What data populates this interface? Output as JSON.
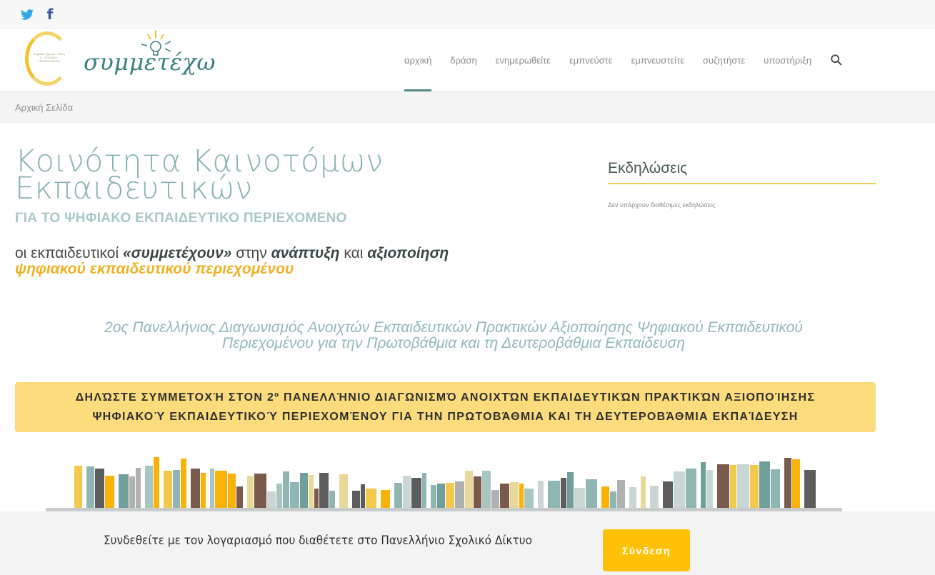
{
  "social": {
    "twitter_icon": "twitter-icon",
    "facebook_glyph": "f"
  },
  "logo": {
    "wordmark": "συμμετέχω",
    "tagline": "Ψηφιακό Σχολείο · Φάση Α · ΣΧΟΛΙΚΟ · ΠΕΡΙΕΧΟΜΕΝΟ"
  },
  "nav": {
    "items": [
      "αρχική",
      "δράση",
      "ενημερωθείτε",
      "εμπνεύστε",
      "εμπνευστείτε",
      "συζητήστε",
      "υποστήριξη"
    ],
    "active_index": 0,
    "search_icon": "search-icon"
  },
  "breadcrumb": "Αρχική Σελίδα",
  "hero": {
    "title_line1": "Κοινότητα Καινοτόμων",
    "title_line2": "Εκπαιδευτικών",
    "subtitle": "ΓΙΑ ΤΟ ΨΗΦΙΑΚΟ ΕΚΠΑΙΔΕΥΤΙΚΟ ΠΕΡΙΕΧΟΜΕΝΟ"
  },
  "tagline": {
    "part1": "οι εκπαιδευτικοί ",
    "bold1": "«συμμετέχουν»",
    "part2": " στην ",
    "bold2": "ανάπτυξη",
    "part3": " και ",
    "bold3": "αξιοποίηση",
    "line2": "ψηφιακού εκπαιδευτικού περιεχομένου"
  },
  "events": {
    "title": "Εκδηλώσεις",
    "empty_text": "Δεν υπάρχουν διαθέσιμες εκδηλώσεις"
  },
  "contest": {
    "line1": "2ος Πανελλήνιος Διαγωνισμός Ανοιχτών Εκπαιδευτικών Πρακτικών Αξιοποίησης Ψηφιακού Εκπαιδευτικού",
    "line2": "Περιεχομένου για την Πρωτοβάθμια και τη Δευτεροβάθμια Εκπαίδευση"
  },
  "banner": {
    "line1": "ΔΗΛΏΣΤΕ ΣΥΜΜΕΤΟΧΉ ΣΤΟΝ 2º ΠΑΝΕΛΛΉΝΙΟ ΔΙΑΓΩΝΙΣΜΌ ΑΝΟΙΧΤΏΝ ΕΚΠΑΙΔΕΥΤΙΚΏΝ ΠΡΑΚΤΙΚΏΝ ΑΞΙΟΠΟΊΗΣΗΣ",
    "line2": "ΨΗΦΙΑΚΟΎ ΕΚΠΑΙΔΕΥΤΙΚΟΎ ΠΕΡΙΕΧΟΜΈΝΟΥ ΓΙΑ ΤΗΝ ΠΡΩΤΟΒΆΘΜΙΑ ΚΑΙ ΤΗ ΔΕΥΤΕΡΟΒΆΘΜΙΑ ΕΚΠΑΊΔΕΥΣΗ"
  },
  "login": {
    "text": "Συνδεθείτε με τον λογαριασμό που διαθέτετε στο Πανελλήνιο Σχολικό Δίκτυο",
    "button": "Σύνδεση"
  },
  "colors": {
    "accent": "#f0b323",
    "teal": "#8ab3b4",
    "banner": "#fbdb7c",
    "button": "#ffc107"
  }
}
